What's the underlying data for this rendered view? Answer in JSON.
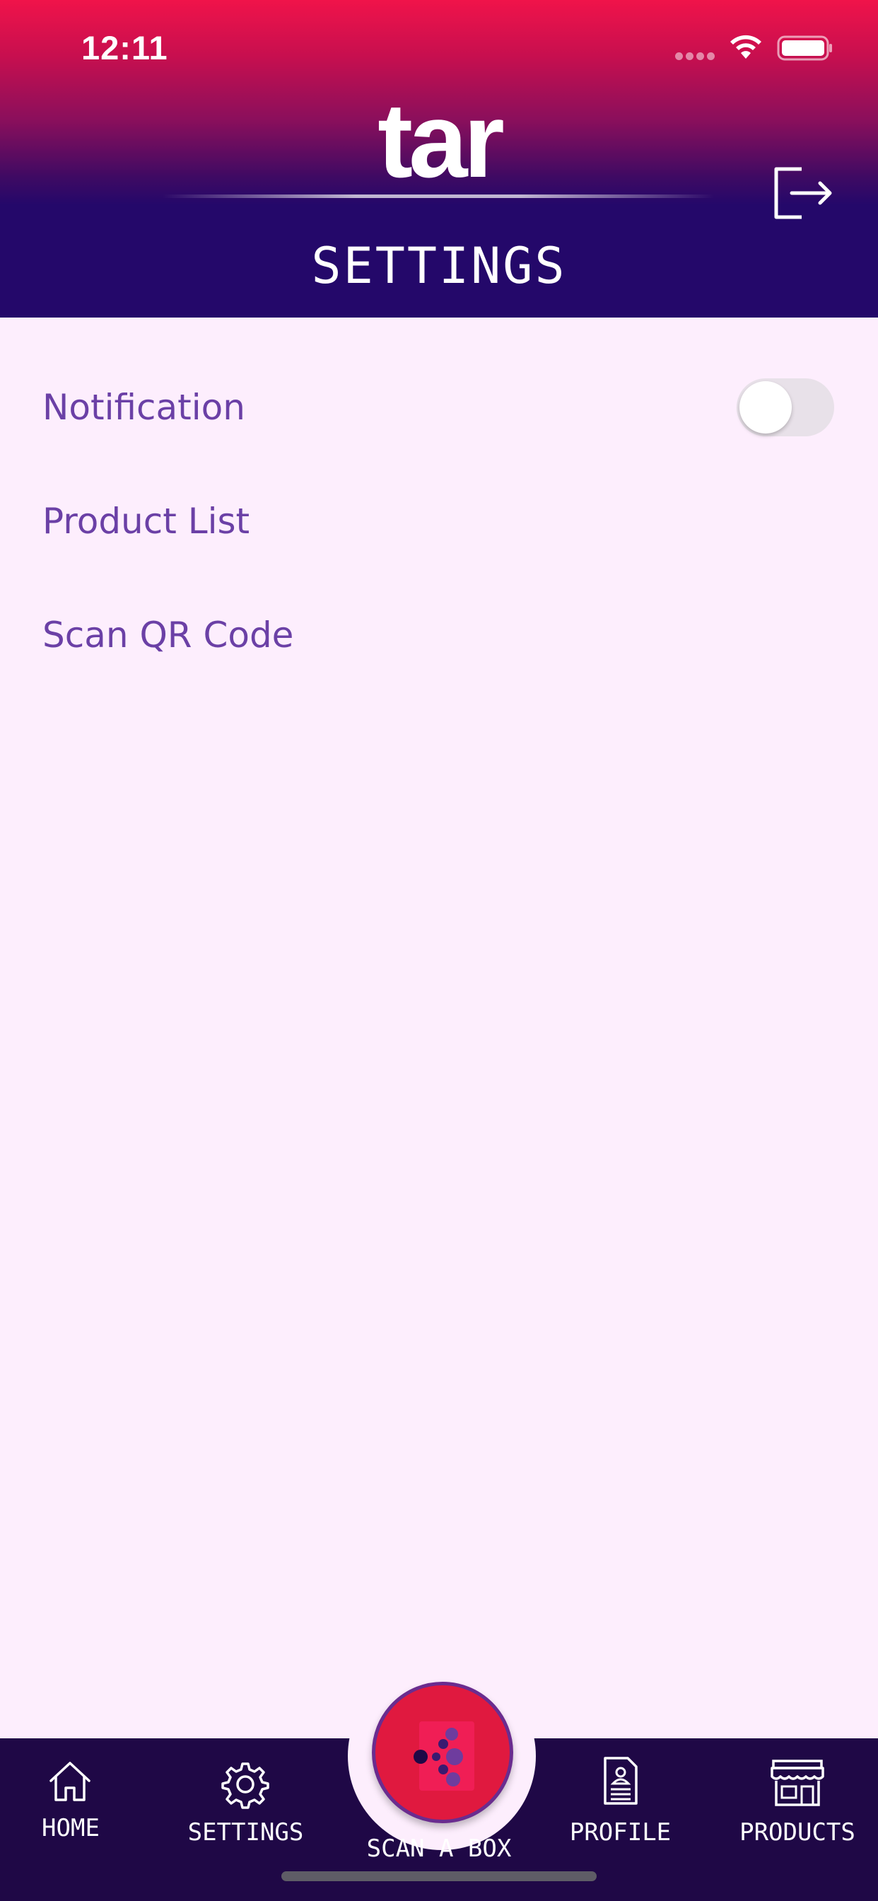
{
  "status_bar": {
    "time": "12:11",
    "icons": [
      "signal-dots-icon",
      "wifi-icon",
      "battery-icon"
    ]
  },
  "header": {
    "logo": "tar",
    "title": "SETTINGS",
    "logout_icon": "logout-icon",
    "colors": {
      "gradient_top": "#F0134A",
      "gradient_bottom": "#24086A"
    }
  },
  "settings": {
    "items": [
      {
        "label": "Notification",
        "toggle_on": false
      },
      {
        "label": "Product List"
      },
      {
        "label": "Scan QR Code"
      }
    ]
  },
  "bottom_nav": {
    "items": [
      {
        "label": "HOME",
        "icon": "home-icon"
      },
      {
        "label": "SETTINGS",
        "icon": "gear-icon"
      },
      {
        "label": "SCAN A BOX",
        "icon": "scan-box-icon"
      },
      {
        "label": "PROFILE",
        "icon": "profile-document-icon"
      },
      {
        "label": "PRODUCTS",
        "icon": "store-icon"
      }
    ]
  },
  "colors": {
    "background": "#FDEEFD",
    "label": "#6B40A6",
    "nav_background": "#1F0846",
    "scan_button": "#E0193F"
  }
}
